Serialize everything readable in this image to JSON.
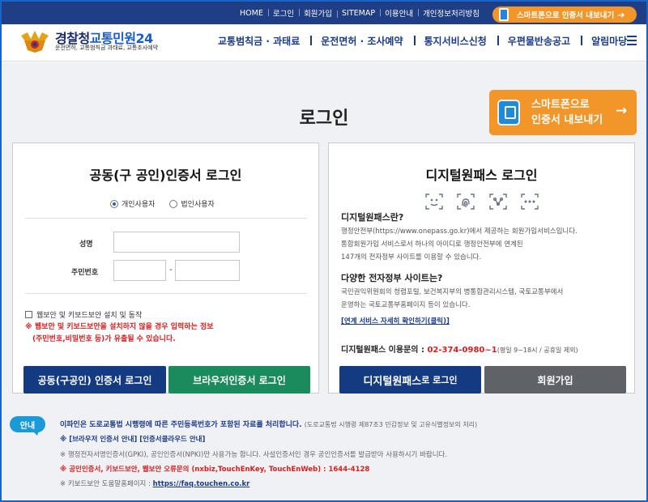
{
  "topbar": {
    "links": [
      "HOME",
      "로그인",
      "회원가입",
      "SITEMAP",
      "이용안내",
      "개인정보처리방침"
    ],
    "smart_button": "스마트폰으로 인증서 내보내기",
    "smart_arrow": "➔"
  },
  "header": {
    "logo_title_1": "경찰청",
    "logo_title_2": "교통민원24",
    "logo_subtitle": "운전면허, 교통범칙금 과태료, 교통조사예약",
    "nav": [
      "교통범칙금 · 과태료",
      "운전면허 · 조사예약",
      "통지서비스신청",
      "우편물반송공고",
      "알림마당"
    ]
  },
  "page": {
    "title": "로그인",
    "smart_btn_line1": "스마트폰으로",
    "smart_btn_line2": "인증서 내보내기",
    "smart_btn_arrow": "→"
  },
  "cert_panel": {
    "title": "공동(구 공인)인증서 로그인",
    "radio_personal": "개인사용자",
    "radio_corporate": "법인사용자",
    "selected": "개인사용자",
    "name_label": "성명",
    "rrn_label": "주민번호",
    "rrn_sep": "-",
    "name_value": "",
    "rrn_front_value": "",
    "rrn_back_value": "",
    "security_check_label": "웹보안 및 키보드보안 설치 및 동작",
    "warning_line1": "※ 웹보안 및 키보드보안을 설치하지 않을 경우 입력하는 정보",
    "warning_line2": "(주민번호,비밀번호 등)가 유출될 수 있습니다.",
    "btn_cert_login": "공동(구공인) 인증서 로그인",
    "btn_browser_login": "브라우저인증서 로그인"
  },
  "onepass_panel": {
    "title": "디지털원패스 로그인",
    "bio_icons": [
      "face-id-icon",
      "fingerprint-icon",
      "pattern-icon",
      "pin-icon"
    ],
    "what_title": "디지털원패스란?",
    "what_body_1": "행정안전부(https://www.onepass.go.kr)에서 제공하는 회원가입서비스입니다.",
    "what_body_2": "통합회원가입 서비스로서 하나의 아이디로 행정안전부에 연계된",
    "what_body_3": "147개의 전자정부 사이트를 이용할 수 있습니다.",
    "sites_title": "다양한 전자정부 사이트는?",
    "sites_body_1": "국민권익위원회의 청렴포털, 보건복지부의 병통합관리시스템, 국토교통부에서",
    "sites_body_2": "운영하는 국토교통부홈페이지 등이 있습니다.",
    "sites_link": "[연계 서비스 자세히 확인하기(클릭)]",
    "inquiry_label": "디지털원패스 이용문의 : ",
    "inquiry_phone": "02-374-0980~1",
    "inquiry_hours": "(평일 9~18시 / 공휴일 제외)",
    "btn_onepass_login_a": "디지털원패스",
    "btn_onepass_login_b": " 로 로그인",
    "btn_join": "회원가입"
  },
  "notice": {
    "badge": "안내",
    "line1_bold": "이파인은 도로교통법 시행령에 따른 주민등록번호가 포함된 자료를 처리합니다.",
    "line1_plain": "(도로교통법 시행령 제87조3 민감정보 및 고유식별정보의 처리)",
    "line2": "※ [브라우저 인증서 안내] [인증서클라우드 안내]",
    "line3": "※ 행정전자서명인증서(GPKI), 공인인증서(NPKI)만 사용가능 합니다. 사설인증서인 경우 공인인증서를 발급받아 사용하시기 바랍니다.",
    "line4": "※ 공인인증서, 키보드보안, 웹보안 오류문의 (nxbiz,TouchEnKey, TouchEnWeb) : 1644-4128",
    "line5_prefix": "※ 키보드보안 도움말홈페이지 : ",
    "line5_link": "https://faq.touchen.co.kr"
  },
  "colors": {
    "topbar": "#1f3e86",
    "accent_orange": "#f3962a",
    "navy_button": "#143a82",
    "green_button": "#1b8a5c",
    "gray_button": "#5f6368",
    "warning_red": "#d62020"
  }
}
